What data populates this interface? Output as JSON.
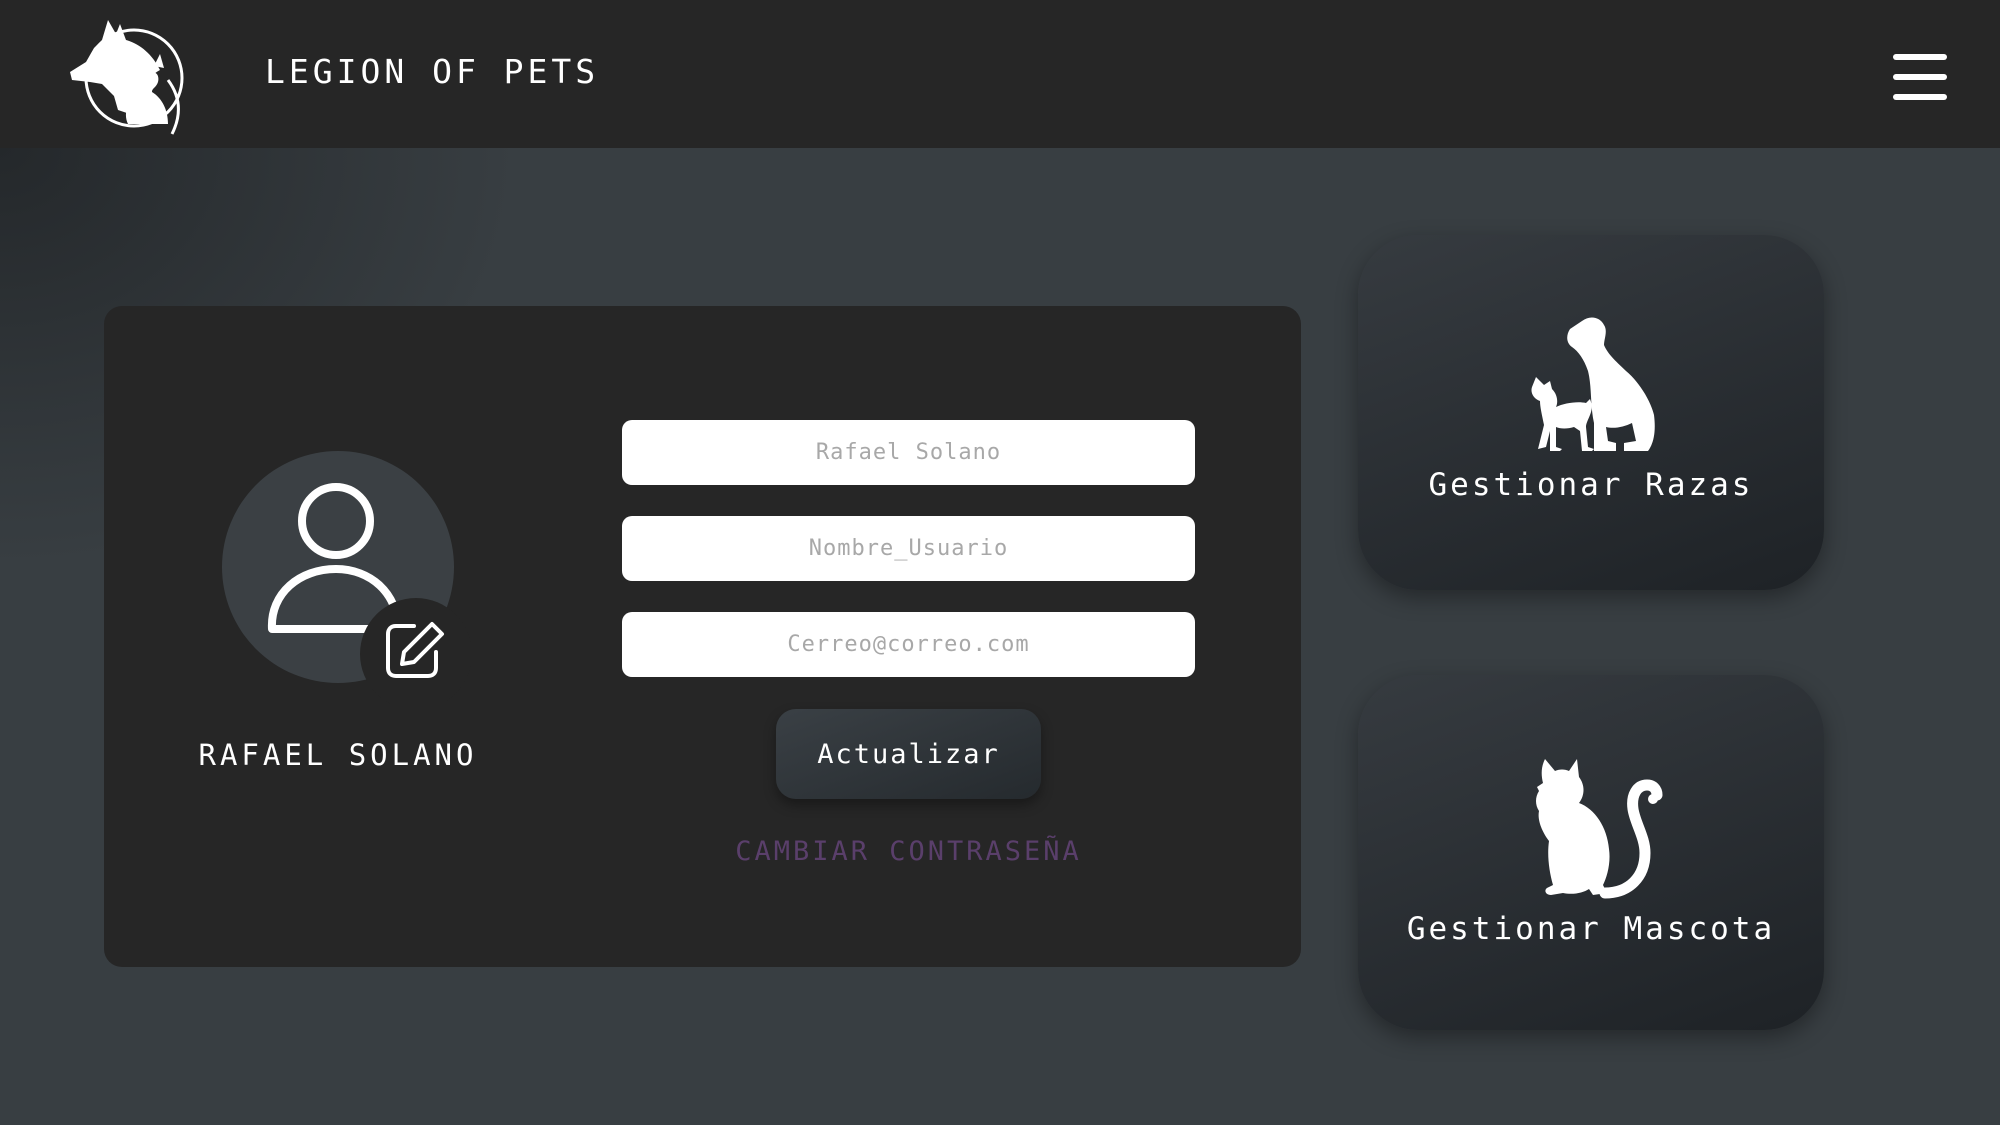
{
  "header": {
    "brand": "LEGION OF PETS",
    "logo_icon": "pets-logo-icon",
    "menu_icon": "hamburger-menu-icon"
  },
  "profile": {
    "name": "RAFAEL SOLANO",
    "avatar_icon": "user-avatar-icon",
    "edit_icon": "edit-pencil-icon",
    "fields": {
      "full_name_placeholder": "Rafael Solano",
      "username_placeholder": "Nombre_Usuario",
      "email_placeholder": "Cerreo@correo.com"
    },
    "update_label": "Actualizar",
    "change_password_label": "CAMBIAR CONTRASEÑA"
  },
  "tiles": {
    "breeds": {
      "label": "Gestionar Razas",
      "icon": "dogs-icon"
    },
    "pets": {
      "label": "Gestionar Mascota",
      "icon": "cat-icon"
    }
  },
  "colors": {
    "background": "#383e42",
    "header": "#262626",
    "card": "#262626",
    "link": "#5a3f6b"
  }
}
